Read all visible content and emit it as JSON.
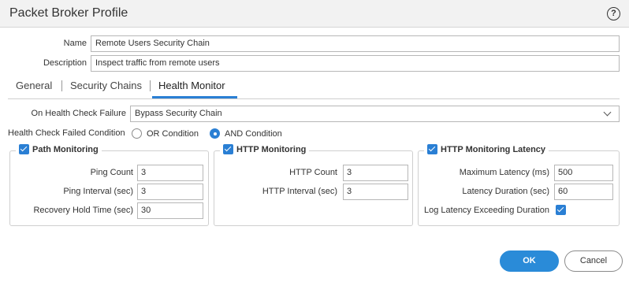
{
  "dialog": {
    "title": "Packet Broker Profile",
    "help_icon": "question-circle-icon",
    "help_glyph": "?"
  },
  "form": {
    "name_label": "Name",
    "name_value": "Remote Users Security Chain",
    "description_label": "Description",
    "description_value": "Inspect traffic from remote users"
  },
  "tabs": [
    {
      "label": "General",
      "active": false
    },
    {
      "label": "Security Chains",
      "active": false
    },
    {
      "label": "Health Monitor",
      "active": true
    }
  ],
  "health": {
    "failure_label": "On Health Check Failure",
    "failure_value": "Bypass Security Chain",
    "condition_label": "Health Check Failed Condition",
    "conditions": [
      {
        "label": "OR Condition",
        "selected": false
      },
      {
        "label": "AND Condition",
        "selected": true
      }
    ]
  },
  "path_monitoring": {
    "title": "Path Monitoring",
    "enabled": true,
    "fields": [
      {
        "label": "Ping Count",
        "value": "3"
      },
      {
        "label": "Ping Interval (sec)",
        "value": "3"
      },
      {
        "label": "Recovery Hold Time (sec)",
        "value": "30"
      }
    ]
  },
  "http_monitoring": {
    "title": "HTTP Monitoring",
    "enabled": true,
    "fields": [
      {
        "label": "HTTP Count",
        "value": "3"
      },
      {
        "label": "HTTP Interval (sec)",
        "value": "3"
      }
    ]
  },
  "http_latency": {
    "title": "HTTP Monitoring Latency",
    "enabled": true,
    "fields": [
      {
        "label": "Maximum Latency (ms)",
        "value": "500"
      },
      {
        "label": "Latency Duration (sec)",
        "value": "60"
      }
    ],
    "log_label": "Log Latency Exceeding Duration",
    "log_checked": true
  },
  "buttons": {
    "ok": "OK",
    "cancel": "Cancel"
  },
  "colors": {
    "accent": "#2a7fd4",
    "ok_button": "#2a8bd8"
  }
}
